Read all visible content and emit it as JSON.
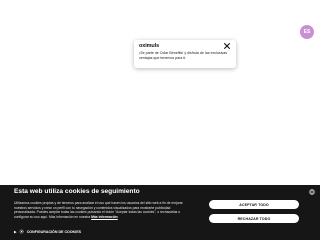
{
  "fab": {
    "label": "ES",
    "color": "#c98fd3"
  },
  "promo": {
    "logo": "oximuls",
    "text": "¡Se parte de Oclar Benefits! y disfruta de las exclusivas ventajas que tenemos para ti."
  },
  "cookie_banner": {
    "title": "Esta web utiliza cookies de seguimiento",
    "body": "Utilizamos cookies propias y de terceros para analizar el uso que hacen los usuarios del sitio web a fin de mejorar nuestros servicios y crear un perfil con tu navegación y contenidos visualizados para mostrarte publicidad personalizada. Puedes aceptar todas las cookies pulsando el botón \"Aceptar todas las cookies\", o rechazarlas o configurar su uso aquí. Más información en nuestra",
    "link_text": "Más información",
    "accept_label": "ACEPTAR TODO",
    "reject_label": "RECHAZAR TODO",
    "config_label": "CONFIGURACIÓN DE COOKIES",
    "background": "#161616"
  }
}
